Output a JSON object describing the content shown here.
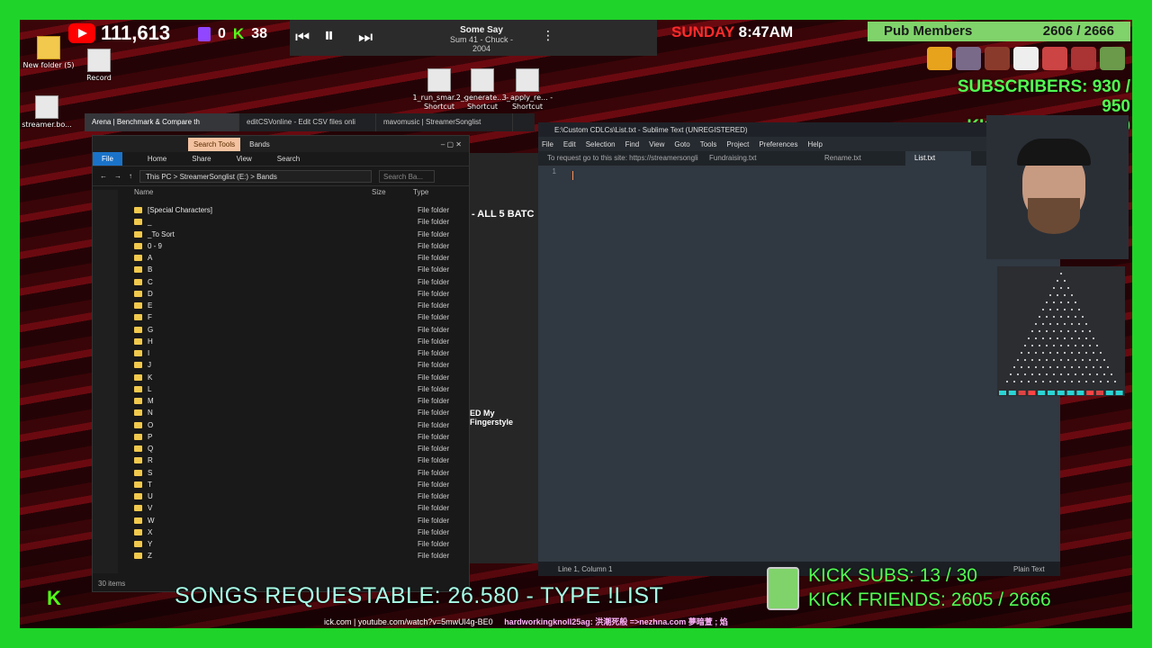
{
  "overlay": {
    "youtube_subs": "111,613",
    "twitch_count": "0",
    "kick_count": "38",
    "song_title": "Some Say",
    "song_artist": "Sum 41 - Chuck - 2004",
    "day": "SUNDAY",
    "time": "8:47AM",
    "pub_label": "Pub Members",
    "pub_count": "2606 / 2666",
    "subscribers": "SUBSCRIBERS: 930 / 950",
    "kicks": "KICKS: 9989 / 10000",
    "songs_requestable": "SONGS REQUESTABLE: 26.580 - TYPE !LIST",
    "kick_subs": "KICK SUBS: 13 / 30",
    "kick_friends": "KICK FRIENDS: 2605 / 2666",
    "ticker_a": "ick.com | youtube.com/watch?v=5mwUl4g-BE0",
    "ticker_b": "hardworkingknoll25ag: 洪潮死般 =>nezhna.com 夢暗萱 ; 焰"
  },
  "desktop": {
    "icons": [
      {
        "label": "New folder (5)"
      },
      {
        "label": "Record"
      },
      {
        "label": "streamer.bo..."
      },
      {
        "label": "1_run_smar... - Shortcut"
      },
      {
        "label": "2_generate... - Shortcut"
      },
      {
        "label": "3_apply_re... - Shortcut"
      }
    ]
  },
  "browser": {
    "tabs": [
      {
        "label": "Arena | Benchmark & Compare th"
      },
      {
        "label": "editCSVonline - Edit CSV files onli"
      },
      {
        "label": "mavomusic | StreamerSonglist"
      }
    ],
    "behind_text_1": "- ALL 5 BATC",
    "behind_text_2": "ED My Fingerstyle"
  },
  "explorer": {
    "search_tools": "Search Tools",
    "title": "Bands",
    "ribbon": [
      "File",
      "Home",
      "Share",
      "View",
      "Search"
    ],
    "breadcrumb": "This PC  >  StreamerSonglist (E:)  >  Bands",
    "search_placeholder": "Search Ba...",
    "col_name": "Name",
    "col_size": "Size",
    "col_type": "Type",
    "rows": [
      {
        "name": "[Special Characters]",
        "type": "File folder"
      },
      {
        "name": "_",
        "type": "File folder"
      },
      {
        "name": "_To Sort",
        "type": "File folder"
      },
      {
        "name": "0 - 9",
        "type": "File folder"
      },
      {
        "name": "A",
        "type": "File folder"
      },
      {
        "name": "B",
        "type": "File folder"
      },
      {
        "name": "C",
        "type": "File folder"
      },
      {
        "name": "D",
        "type": "File folder"
      },
      {
        "name": "E",
        "type": "File folder"
      },
      {
        "name": "F",
        "type": "File folder"
      },
      {
        "name": "G",
        "type": "File folder"
      },
      {
        "name": "H",
        "type": "File folder"
      },
      {
        "name": "I",
        "type": "File folder"
      },
      {
        "name": "J",
        "type": "File folder"
      },
      {
        "name": "K",
        "type": "File folder"
      },
      {
        "name": "L",
        "type": "File folder"
      },
      {
        "name": "M",
        "type": "File folder"
      },
      {
        "name": "N",
        "type": "File folder"
      },
      {
        "name": "O",
        "type": "File folder"
      },
      {
        "name": "P",
        "type": "File folder"
      },
      {
        "name": "Q",
        "type": "File folder"
      },
      {
        "name": "R",
        "type": "File folder"
      },
      {
        "name": "S",
        "type": "File folder"
      },
      {
        "name": "T",
        "type": "File folder"
      },
      {
        "name": "U",
        "type": "File folder"
      },
      {
        "name": "V",
        "type": "File folder"
      },
      {
        "name": "W",
        "type": "File folder"
      },
      {
        "name": "X",
        "type": "File folder"
      },
      {
        "name": "Y",
        "type": "File folder"
      },
      {
        "name": "Z",
        "type": "File folder"
      }
    ],
    "status": "30 items"
  },
  "sublime": {
    "title": "E:\\Custom CDLCs\\List.txt - Sublime Text (UNREGISTERED)",
    "menu": [
      "File",
      "Edit",
      "Selection",
      "Find",
      "View",
      "Goto",
      "Tools",
      "Project",
      "Preferences",
      "Help"
    ],
    "tabs": [
      {
        "label": "To request go to this site: https://streamersongli"
      },
      {
        "label": "Fundraising.txt"
      },
      {
        "label": "Rename.txt"
      },
      {
        "label": "List.txt"
      }
    ],
    "line_number": "1",
    "status_left": "Line 1, Column 1",
    "status_right": "Plain Text"
  }
}
